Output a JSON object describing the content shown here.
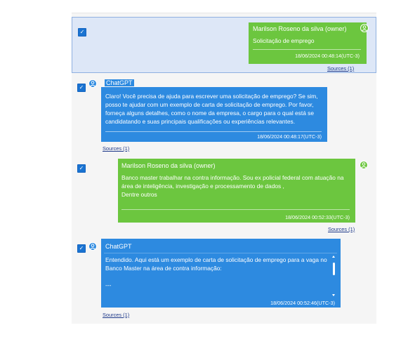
{
  "messages": [
    {
      "sender": "Marilson Roseno da silva (owner)",
      "text": "Solicitação de emprego",
      "timestamp": "18/06/2024 00:48:14(UTC-3)",
      "sources": "Sources (1)",
      "selected": true,
      "checked": true
    },
    {
      "sender": "ChatGPT",
      "text": "Claro! Você precisa de ajuda para escrever uma solicitação de emprego? Se sim, posso te ajudar com um exemplo de carta de solicitação de emprego. Por favor, forneça alguns detalhes, como o nome da empresa, o cargo para o qual está se candidatando e suas principais qualificações ou experiências relevantes.",
      "timestamp": "18/06/2024 00:48:17(UTC-3)",
      "sources": "Sources (1)",
      "checked": true
    },
    {
      "sender": "Marilson Roseno da silva (owner)",
      "text": "Banco master trabalhar na contra informação. Sou ex policial federal com atuação na área de inteligência, investigação e processamento de dados ,\nDentre outros",
      "timestamp": "18/06/2024 00:52:33(UTC-3)",
      "sources": "Sources (1)",
      "checked": true
    },
    {
      "sender": "ChatGPT",
      "text": "Entendido. Aqui está um exemplo de carta de solicitação de emprego para a vaga no Banco Master na área de contra informação:\n\n---",
      "timestamp": "18/06/2024 00:52:46(UTC-3)",
      "sources": "Sources (1)",
      "checked": true
    }
  ],
  "icons": {
    "checkbox": "checkmark-icon",
    "avatar": "user-avatar-icon"
  },
  "colors": {
    "user_bubble": "#6cc63f",
    "gpt_bubble": "#2d8ae0",
    "selected_row": "#dde7f7",
    "checkbox": "#1a73d1",
    "link": "#1f3a8a"
  }
}
